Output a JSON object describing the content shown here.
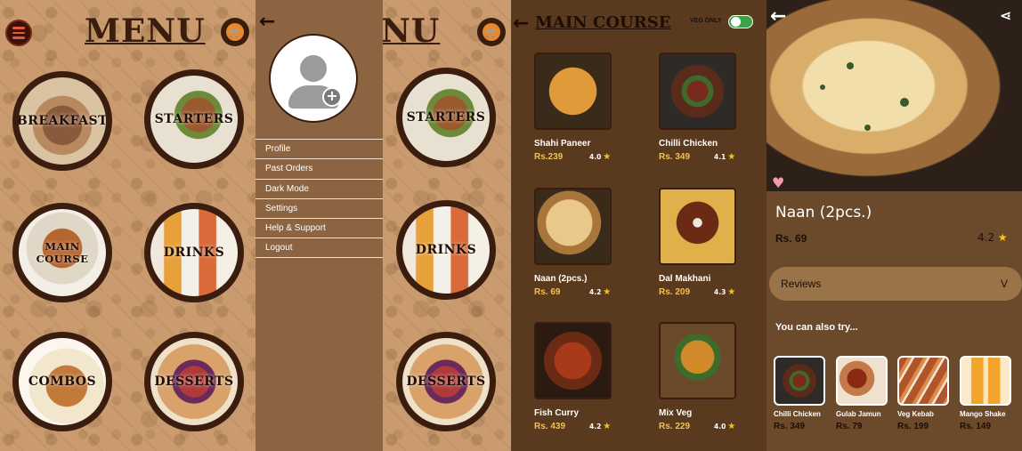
{
  "home": {
    "title": "MENU",
    "categories": [
      {
        "label": "BREAKFAST"
      },
      {
        "label": "STARTERS"
      },
      {
        "label": "MAIN COURSE"
      },
      {
        "label": "DRINKS"
      },
      {
        "label": "COMBOS"
      },
      {
        "label": "DESSERTS"
      }
    ],
    "menu_icon": "hamburger-menu-icon",
    "cart_icon": "cart-icon"
  },
  "drawer": {
    "back_icon": "back-arrow-icon",
    "avatar_icon": "user-avatar-icon",
    "items": [
      {
        "label": "Profile"
      },
      {
        "label": "Past Orders"
      },
      {
        "label": "Dark Mode"
      },
      {
        "label": "Settings"
      },
      {
        "label": "Help & Support"
      },
      {
        "label": "Logout"
      }
    ]
  },
  "peek": {
    "title_fragment": "NU",
    "categories": [
      {
        "label": "STARTERS"
      },
      {
        "label": "DRINKS"
      },
      {
        "label": "DESSERTS"
      }
    ]
  },
  "main_course": {
    "title": "MAIN COURSE",
    "veg_only_label": "VEG ONLY",
    "veg_only_on": true,
    "dishes": [
      {
        "name": "Shahi Paneer",
        "price": "Rs.239",
        "rating": "4.0"
      },
      {
        "name": "Chilli Chicken",
        "price": "Rs. 349",
        "rating": "4.1"
      },
      {
        "name": "Naan (2pcs.)",
        "price": "Rs. 69",
        "rating": "4.2"
      },
      {
        "name": "Dal Makhani",
        "price": "Rs. 209",
        "rating": "4.3"
      },
      {
        "name": "Fish Curry",
        "price": "Rs. 439",
        "rating": "4.2"
      },
      {
        "name": "Mix Veg",
        "price": "Rs. 229",
        "rating": "4.0"
      }
    ]
  },
  "detail": {
    "name": "Naan (2pcs.)",
    "price": "Rs. 69",
    "rating": "4.2",
    "reviews_label": "Reviews",
    "reviews_chevron": "V",
    "also_try_label": "You can also try...",
    "suggestions": [
      {
        "name": "Chilli Chicken",
        "price": "Rs. 349"
      },
      {
        "name": "Gulab Jamun",
        "price": "Rs. 79"
      },
      {
        "name": "Veg Kebab",
        "price": "Rs. 199"
      },
      {
        "name": "Mango Shake",
        "price": "Rs. 149"
      }
    ]
  },
  "colors": {
    "brown_dark": "#3b1d0f",
    "tan_bg": "#c99b6e",
    "price_gold": "#f2c14e",
    "star": "#f5c518",
    "toggle_green": "#3ea14a"
  }
}
